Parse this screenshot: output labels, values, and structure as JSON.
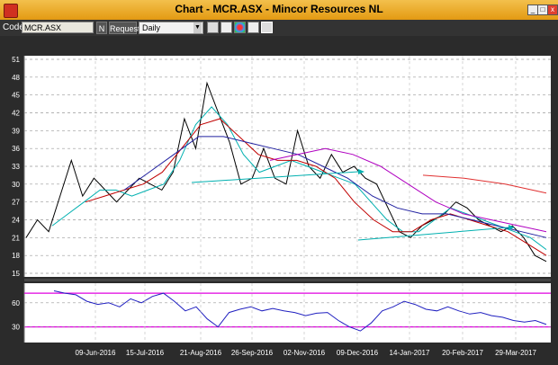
{
  "window": {
    "title": "Chart - MCR.ASX - Mincor Resources NL"
  },
  "toolbar": {
    "code_label": "Code:",
    "code_value": "MCR.ASX",
    "n_button": "N",
    "request_button": "Request",
    "period_selected": "Daily"
  },
  "price_axis": {
    "ticks": [
      "51",
      "48",
      "45",
      "42",
      "39",
      "36",
      "33",
      "30",
      "27",
      "24",
      "21",
      "18",
      "15"
    ],
    "range": [
      15,
      51
    ]
  },
  "osc_axis": {
    "ticks": [
      "60",
      "30"
    ],
    "bands": [
      72,
      30
    ]
  },
  "date_axis": {
    "ticks": [
      "09-Jun-2016",
      "15-Jul-2016",
      "21-Aug-2016",
      "26-Sep-2016",
      "02-Nov-2016",
      "09-Dec-2016",
      "14-Jan-2017",
      "20-Feb-2017",
      "29-Mar-2017"
    ]
  },
  "colors": {
    "price": "#000000",
    "ma_short": "#00b0b0",
    "ma_mid": "#c00000",
    "ma_long": "#2020a0",
    "ma_xlong": "#b000c0",
    "ma_far": "#e03030",
    "osc": "#2020c0",
    "band": "#e000e0"
  },
  "chart_data": {
    "type": "line",
    "series": [
      {
        "values": [
          21,
          24,
          22,
          28,
          34,
          28,
          31,
          29,
          27,
          29,
          31,
          30,
          29,
          32,
          41,
          36,
          47,
          42,
          37,
          30,
          31,
          36,
          31,
          30,
          39,
          33,
          31,
          35,
          32,
          33,
          31,
          30,
          26,
          22,
          21,
          23,
          24,
          25,
          27,
          26,
          24,
          23,
          22,
          23,
          21,
          18,
          17
        ]
      },
      {
        "values": [
          23,
          25,
          27,
          29,
          29,
          28,
          29,
          30,
          34,
          40,
          43,
          40,
          35,
          32,
          33,
          34,
          33,
          32,
          31,
          30,
          27,
          24,
          22,
          22,
          24,
          26,
          25,
          24,
          23,
          22,
          21,
          19
        ]
      },
      {
        "values": [
          27,
          28,
          29,
          30,
          32,
          36,
          40,
          41,
          38,
          35,
          34,
          34,
          33,
          31,
          27,
          24,
          22,
          22,
          24,
          25,
          24,
          23,
          22,
          20,
          18
        ]
      },
      {
        "values": [
          29,
          32,
          35,
          38,
          38,
          37,
          36,
          35,
          33,
          31,
          28,
          26,
          25,
          25,
          24,
          23,
          22,
          21
        ]
      },
      {
        "values": [
          34,
          35,
          36,
          35,
          33,
          30,
          27,
          25,
          24,
          23,
          22
        ]
      },
      {
        "values": [
          31.5,
          31,
          30,
          28.5
        ]
      }
    ],
    "osc_values": [
      75,
      72,
      70,
      62,
      58,
      60,
      55,
      65,
      60,
      68,
      72,
      62,
      50,
      55,
      40,
      30,
      48,
      52,
      55,
      50,
      53,
      50,
      48,
      44,
      47,
      48,
      38,
      30,
      25,
      35,
      50,
      55,
      62,
      58,
      52,
      50,
      55,
      50,
      46,
      48,
      44,
      42,
      38,
      36,
      38,
      33
    ]
  }
}
